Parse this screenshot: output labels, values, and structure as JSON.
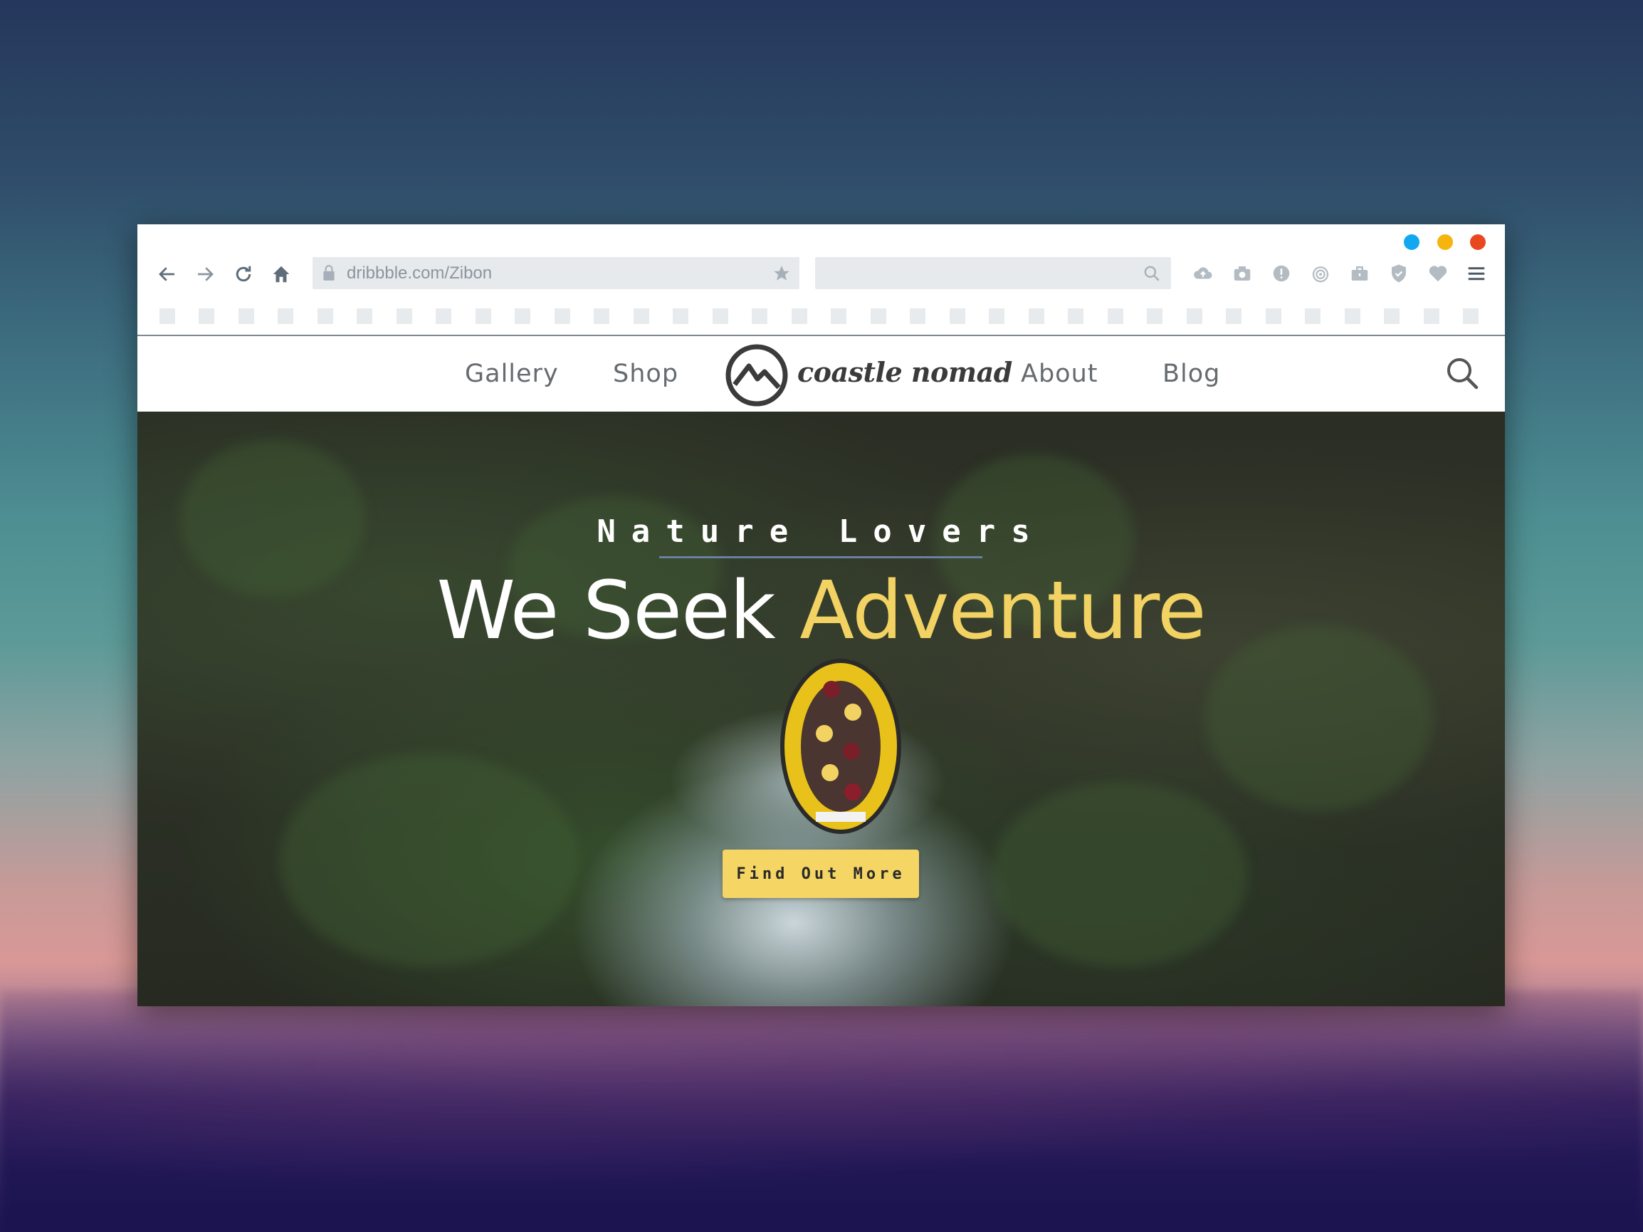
{
  "browser": {
    "url": "dribbble.com/Zibon",
    "search_placeholder": "",
    "traffic_colors": {
      "minimize": "#12a8f0",
      "maximize": "#f5b50e",
      "close": "#e8481f"
    },
    "toolbar_icons": [
      "cloud-upload-icon",
      "camera-icon",
      "alert-icon",
      "wifi-icon",
      "briefcase-icon",
      "shield-icon",
      "heart-icon",
      "menu-icon"
    ]
  },
  "site": {
    "nav": {
      "gallery": "Gallery",
      "shop": "Shop",
      "about": "About",
      "blog": "Blog"
    },
    "brand": "coastle nomad"
  },
  "hero": {
    "subtitle": "Nature Lovers",
    "title_white": "We Seek ",
    "title_accent": "Adventure",
    "cta": "Find Out More",
    "accent_color": "#f2d262"
  }
}
